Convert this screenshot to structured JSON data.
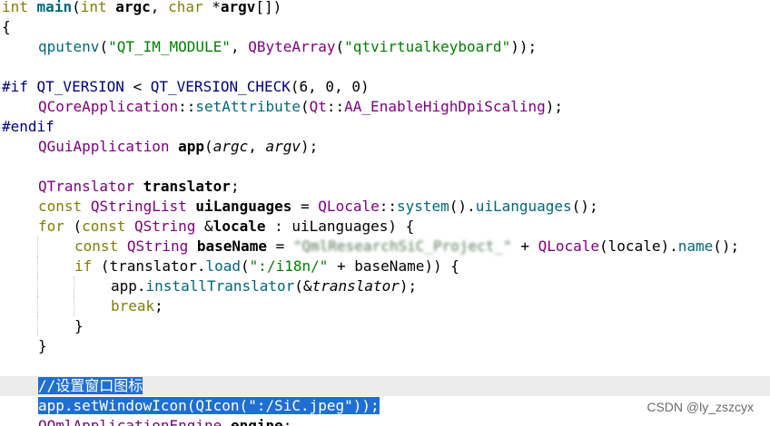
{
  "editor": {
    "current_line_index": 19,
    "lines": [
      {
        "tokens": [
          {
            "t": "int",
            "c": "kw"
          },
          {
            "t": " ",
            "c": "op"
          },
          {
            "t": "main",
            "c": "fn b"
          },
          {
            "t": "(",
            "c": "op"
          },
          {
            "t": "int",
            "c": "kw"
          },
          {
            "t": " ",
            "c": "op"
          },
          {
            "t": "argc",
            "c": "b"
          },
          {
            "t": ", ",
            "c": "op"
          },
          {
            "t": "char",
            "c": "kw"
          },
          {
            "t": " *",
            "c": "op"
          },
          {
            "t": "argv",
            "c": "b"
          },
          {
            "t": "[])",
            "c": "op"
          }
        ]
      },
      {
        "tokens": [
          {
            "t": "{",
            "c": "op"
          }
        ]
      },
      {
        "indent": 1,
        "tokens": [
          {
            "t": "qputenv",
            "c": "fn"
          },
          {
            "t": "(",
            "c": "op"
          },
          {
            "t": "\"QT_IM_MODULE\"",
            "c": "str"
          },
          {
            "t": ", ",
            "c": "op"
          },
          {
            "t": "QByteArray",
            "c": "ty"
          },
          {
            "t": "(",
            "c": "op"
          },
          {
            "t": "\"qtvirtualkeyboard\"",
            "c": "str"
          },
          {
            "t": "));",
            "c": "op"
          }
        ]
      },
      {
        "tokens": []
      },
      {
        "tokens": [
          {
            "t": "#if ",
            "c": "pp"
          },
          {
            "t": "QT_VERSION",
            "c": "pp"
          },
          {
            "t": " < ",
            "c": "op"
          },
          {
            "t": "QT_VERSION_CHECK",
            "c": "pp"
          },
          {
            "t": "(6, 0, 0)",
            "c": "op"
          }
        ]
      },
      {
        "indent": 1,
        "tokens": [
          {
            "t": "QCoreApplication",
            "c": "ty"
          },
          {
            "t": "::",
            "c": "op"
          },
          {
            "t": "setAttribute",
            "c": "fn"
          },
          {
            "t": "(",
            "c": "op"
          },
          {
            "t": "Qt",
            "c": "ty"
          },
          {
            "t": "::",
            "c": "op"
          },
          {
            "t": "AA_EnableHighDpiScaling",
            "c": "ty"
          },
          {
            "t": ");",
            "c": "op"
          }
        ]
      },
      {
        "tokens": [
          {
            "t": "#endif",
            "c": "pp"
          }
        ]
      },
      {
        "indent": 1,
        "tokens": [
          {
            "t": "QGuiApplication",
            "c": "ty"
          },
          {
            "t": " ",
            "c": "op"
          },
          {
            "t": "app",
            "c": "b"
          },
          {
            "t": "(",
            "c": "op"
          },
          {
            "t": "argc",
            "c": "it"
          },
          {
            "t": ", ",
            "c": "op"
          },
          {
            "t": "argv",
            "c": "it"
          },
          {
            "t": ");",
            "c": "op"
          }
        ]
      },
      {
        "tokens": []
      },
      {
        "indent": 1,
        "tokens": [
          {
            "t": "QTranslator",
            "c": "ty"
          },
          {
            "t": " ",
            "c": "op"
          },
          {
            "t": "translator",
            "c": "b"
          },
          {
            "t": ";",
            "c": "op"
          }
        ]
      },
      {
        "indent": 1,
        "tokens": [
          {
            "t": "const",
            "c": "kw"
          },
          {
            "t": " ",
            "c": "op"
          },
          {
            "t": "QStringList",
            "c": "ty"
          },
          {
            "t": " ",
            "c": "op"
          },
          {
            "t": "uiLanguages",
            "c": "b"
          },
          {
            "t": " = ",
            "c": "op"
          },
          {
            "t": "QLocale",
            "c": "ty"
          },
          {
            "t": "::",
            "c": "op"
          },
          {
            "t": "system",
            "c": "fn"
          },
          {
            "t": "().",
            "c": "op"
          },
          {
            "t": "uiLanguages",
            "c": "fn"
          },
          {
            "t": "();",
            "c": "op"
          }
        ]
      },
      {
        "indent": 1,
        "tokens": [
          {
            "t": "for",
            "c": "kw"
          },
          {
            "t": " (",
            "c": "op"
          },
          {
            "t": "const",
            "c": "kw"
          },
          {
            "t": " ",
            "c": "op"
          },
          {
            "t": "QString",
            "c": "ty"
          },
          {
            "t": " &",
            "c": "op"
          },
          {
            "t": "locale",
            "c": "b"
          },
          {
            "t": " : uiLanguages) {",
            "c": "op"
          }
        ]
      },
      {
        "indent": 2,
        "tokens": [
          {
            "t": "const",
            "c": "kw"
          },
          {
            "t": " ",
            "c": "op"
          },
          {
            "t": "QString",
            "c": "ty"
          },
          {
            "t": " ",
            "c": "op"
          },
          {
            "t": "baseName",
            "c": "b"
          },
          {
            "t": " = ",
            "c": "op"
          },
          {
            "t": "\"QmlResearchSiC_Project_\"",
            "c": "str blur"
          },
          {
            "t": " + ",
            "c": "op"
          },
          {
            "t": "QLocale",
            "c": "ty"
          },
          {
            "t": "(locale).",
            "c": "op"
          },
          {
            "t": "name",
            "c": "fn"
          },
          {
            "t": "();",
            "c": "op"
          }
        ]
      },
      {
        "indent": 2,
        "tokens": [
          {
            "t": "if",
            "c": "kw"
          },
          {
            "t": " (translator.",
            "c": "op"
          },
          {
            "t": "load",
            "c": "fn"
          },
          {
            "t": "(",
            "c": "op"
          },
          {
            "t": "\":/i18n/\"",
            "c": "str"
          },
          {
            "t": " + baseName)) {",
            "c": "op"
          }
        ]
      },
      {
        "indent": 3,
        "tokens": [
          {
            "t": "app.",
            "c": "op"
          },
          {
            "t": "installTranslator",
            "c": "fn"
          },
          {
            "t": "(&",
            "c": "op"
          },
          {
            "t": "translator",
            "c": "it"
          },
          {
            "t": ");",
            "c": "op"
          }
        ]
      },
      {
        "indent": 3,
        "tokens": [
          {
            "t": "break",
            "c": "kw"
          },
          {
            "t": ";",
            "c": "op"
          }
        ]
      },
      {
        "indent": 2,
        "tokens": [
          {
            "t": "}",
            "c": "op"
          }
        ]
      },
      {
        "indent": 1,
        "tokens": [
          {
            "t": "}",
            "c": "op"
          }
        ]
      },
      {
        "tokens": []
      },
      {
        "indent": 1,
        "tokens": [
          {
            "t": "//设置窗口图标",
            "c": "sel"
          }
        ]
      },
      {
        "indent": 1,
        "tokens": [
          {
            "t": "app.setWindowIcon(QIcon(\":/SiC.jpeg\"));",
            "c": "sel"
          }
        ]
      },
      {
        "indent": 1,
        "tokens": [
          {
            "t": "QQmlApplicationEngine",
            "c": "ty"
          },
          {
            "t": " ",
            "c": "op"
          },
          {
            "t": "engine",
            "c": "b"
          },
          {
            "t": ";",
            "c": "op"
          }
        ]
      }
    ]
  },
  "watermark": {
    "text": "CSDN @ly_zszcyx"
  },
  "colors": {
    "selection": "#1f6fd1",
    "current_line": "#ececec",
    "keyword": "#808000",
    "type": "#800080",
    "function": "#00677c",
    "string": "#008000",
    "preprocessor": "#000080"
  }
}
